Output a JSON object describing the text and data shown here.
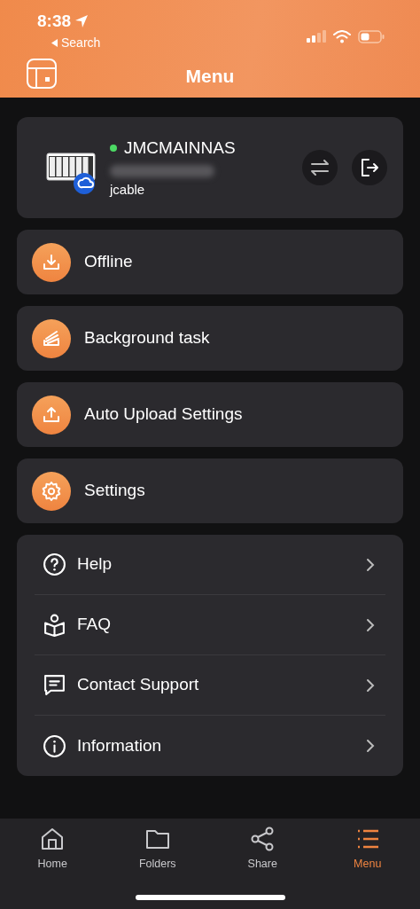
{
  "status_bar": {
    "time": "8:38",
    "back_label": "Search"
  },
  "header": {
    "title": "Menu"
  },
  "device": {
    "name": "JMCMAINNAS",
    "online": true,
    "user": "jcable"
  },
  "features": [
    {
      "kind": "download",
      "label": "Offline"
    },
    {
      "kind": "tasks",
      "label": "Background task"
    },
    {
      "kind": "upload",
      "label": "Auto Upload Settings"
    },
    {
      "kind": "gear",
      "label": "Settings"
    }
  ],
  "support": [
    {
      "kind": "help",
      "label": "Help"
    },
    {
      "kind": "faq",
      "label": "FAQ"
    },
    {
      "kind": "chat",
      "label": "Contact Support"
    },
    {
      "kind": "info",
      "label": "Information"
    }
  ],
  "tabs": [
    {
      "kind": "home",
      "label": "Home",
      "selected": false
    },
    {
      "kind": "folder",
      "label": "Folders",
      "selected": false
    },
    {
      "kind": "share",
      "label": "Share",
      "selected": false
    },
    {
      "kind": "menu",
      "label": "Menu",
      "selected": true
    }
  ]
}
